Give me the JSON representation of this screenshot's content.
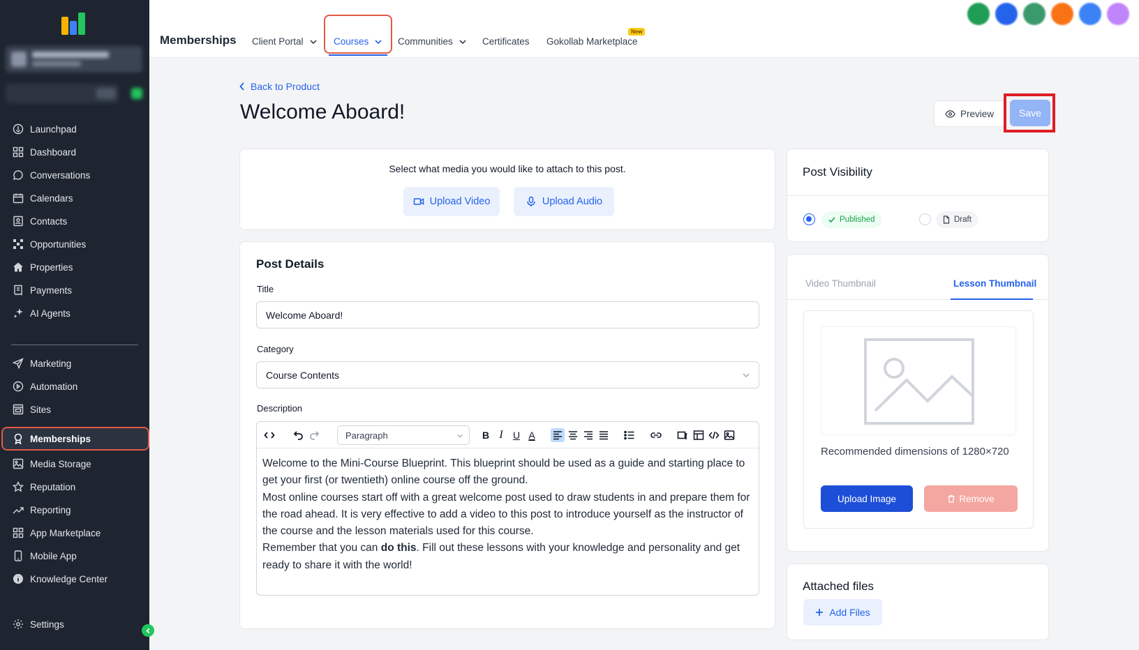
{
  "sidebar": {
    "items_top": [
      {
        "label": "Launchpad",
        "icon": "launchpad-icon"
      },
      {
        "label": "Dashboard",
        "icon": "dashboard-icon"
      },
      {
        "label": "Conversations",
        "icon": "chat-bubble-icon"
      },
      {
        "label": "Calendars",
        "icon": "calendar-icon"
      },
      {
        "label": "Contacts",
        "icon": "contact-card-icon"
      },
      {
        "label": "Opportunities",
        "icon": "network-icon"
      },
      {
        "label": "Properties",
        "icon": "house-icon"
      },
      {
        "label": "Payments",
        "icon": "receipt-icon"
      },
      {
        "label": "AI Agents",
        "icon": "sparkle-icon"
      }
    ],
    "items_bottom": [
      {
        "label": "Marketing",
        "icon": "send-icon"
      },
      {
        "label": "Automation",
        "icon": "automation-icon"
      },
      {
        "label": "Sites",
        "icon": "browser-icon"
      },
      {
        "label": "Memberships",
        "icon": "badge-icon"
      },
      {
        "label": "Media Storage",
        "icon": "image-icon"
      },
      {
        "label": "Reputation",
        "icon": "star-icon"
      },
      {
        "label": "Reporting",
        "icon": "trend-icon"
      },
      {
        "label": "App Marketplace",
        "icon": "grid-icon"
      },
      {
        "label": "Mobile App",
        "icon": "mobile-icon"
      },
      {
        "label": "Knowledge Center",
        "icon": "info-icon"
      }
    ],
    "settings_label": "Settings",
    "active": "Memberships"
  },
  "topbar": {
    "title": "Memberships",
    "tabs": [
      "Client Portal",
      "Courses",
      "Communities",
      "Certificates",
      "Gokollab Marketplace"
    ],
    "active_tab": "Courses",
    "new_badge": "New"
  },
  "page": {
    "back_label": "Back to Product",
    "title": "Welcome Aboard!",
    "preview_label": "Preview",
    "save_label": "Save"
  },
  "media": {
    "prompt": "Select what media you would like to attach to this post.",
    "upload_video": "Upload Video",
    "upload_audio": "Upload Audio"
  },
  "details": {
    "heading": "Post Details",
    "title_label": "Title",
    "title_value": "Welcome Aboard!",
    "category_label": "Category",
    "category_value": "Course Contents",
    "description_label": "Description",
    "paragraph_format": "Paragraph",
    "body": {
      "p1": "Welcome to the Mini-Course Blueprint. This blueprint should be used as a guide and starting place to get your first (or twentieth) online course off the ground.",
      "p2": "Most online courses start off with a great welcome post used to draw students in and prepare them for the road ahead. It is very effective to add a video to this post to introduce yourself as the instructor of the course and the lesson materials used for this course.",
      "p3_before": "Remember that you can ",
      "p3_bold": "do this",
      "p3_after": ". Fill out these lessons with your knowledge and personality and get ready to share it with the world!"
    }
  },
  "visibility": {
    "heading": "Post Visibility",
    "published": "Published",
    "draft": "Draft",
    "selected": "Published"
  },
  "thumbnail": {
    "tab_video": "Video Thumbnail",
    "tab_lesson": "Lesson Thumbnail",
    "active_tab": "Lesson Thumbnail",
    "recommended": "Recommended dimensions of 1280×720",
    "upload_label": "Upload Image",
    "remove_label": "Remove"
  },
  "files": {
    "heading": "Attached files",
    "add_label": "Add Files"
  },
  "colors": {
    "accent": "#2563eb",
    "sidebar_bg": "#1e2530",
    "highlight": "#e05a47",
    "published_green": "#16a34a"
  }
}
